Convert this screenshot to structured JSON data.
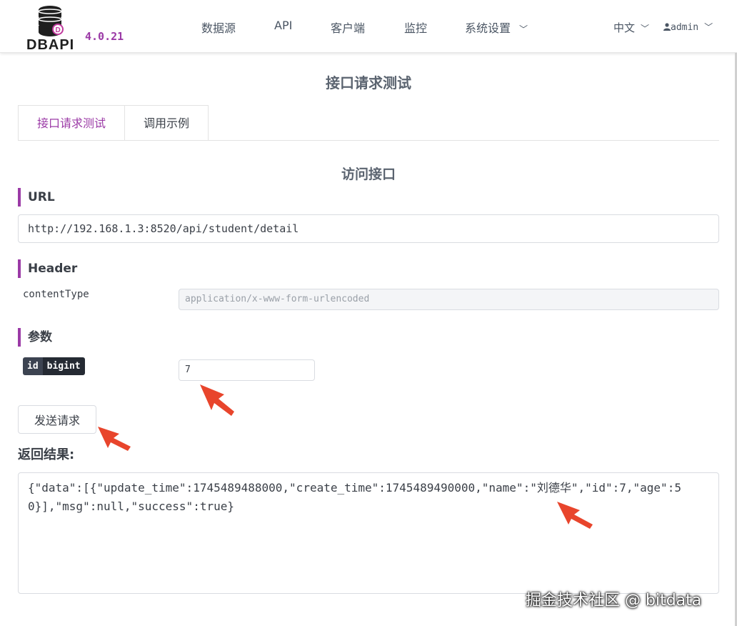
{
  "app": {
    "logo_text": "DBAPI",
    "version": "4.0.21",
    "nav": [
      "数据源",
      "API",
      "客户端",
      "监控",
      "系统设置"
    ],
    "language": "中文",
    "user": "admin"
  },
  "page": {
    "title": "接口请求测试",
    "tabs": [
      "接口请求测试",
      "调用示例"
    ],
    "section_title": "访问接口",
    "url_label": "URL",
    "url_value": "http://192.168.1.3:8520/api/student/detail",
    "header_label": "Header",
    "header_key": "contentType",
    "header_placeholder": "application/x-www-form-urlencoded",
    "params_label": "参数",
    "param_name": "id",
    "param_type": "bigint",
    "param_value": "7",
    "send_button": "发送请求",
    "result_label": "返回结果:",
    "result_text": "{\"data\":[{\"update_time\":1745489488000,\"create_time\":1745489490000,\"name\":\"刘德华\",\"id\":7,\"age\":50}],\"msg\":null,\"success\":true}"
  },
  "watermark": "掘金技术社区 @ bitdata",
  "colors": {
    "accent": "#9b3aa6",
    "arrow": "#e8452c"
  }
}
